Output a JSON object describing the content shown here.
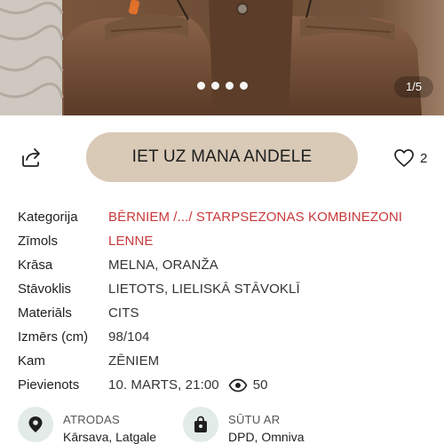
{
  "gallery": {
    "counter": "1/5",
    "dot_count": 4
  },
  "actions": {
    "cta_label": "IET UZ MANA ANDELE",
    "like_count": "2"
  },
  "details": [
    {
      "label": "Kategorija",
      "value": "BĒRNIEM /.../ STARPSEZONAS KOMBINEZONI",
      "link": true
    },
    {
      "label": "Zīmols",
      "value": "LENNE",
      "link": true
    },
    {
      "label": "Krāsa",
      "value": "MELNA, ORANŽA",
      "link": false
    },
    {
      "label": "Stāvoklis",
      "value": "LIETOTS, LIELISKĀ STĀVOKLĪ",
      "link": false
    },
    {
      "label": "Materiāls",
      "value": "CITS",
      "link": false
    },
    {
      "label": "Izmērs (cm)",
      "value": "98/104",
      "link": false
    },
    {
      "label": "Kam",
      "value": "ZĒNIEM",
      "link": false
    },
    {
      "label": "Pievienots",
      "value": "10. MARTS, 21:00",
      "link": false,
      "views": "50"
    }
  ],
  "location": {
    "label": "ATRODAS",
    "value": "Kārsava, Latgale"
  },
  "shipping": {
    "label": "SŪTU AR",
    "value": "DPD, Omniva"
  },
  "icons": {
    "share": "share-icon",
    "heart": "heart-icon",
    "eye": "eye-icon",
    "location": "location-pin-icon",
    "shipping": "shopping-bag-icon"
  },
  "colors": {
    "accent_link": "#c8393a",
    "cta_bg": "#d9cab7",
    "icon_circle_bg": "#e2ebe8",
    "photo_brown": "#6b4a33"
  }
}
